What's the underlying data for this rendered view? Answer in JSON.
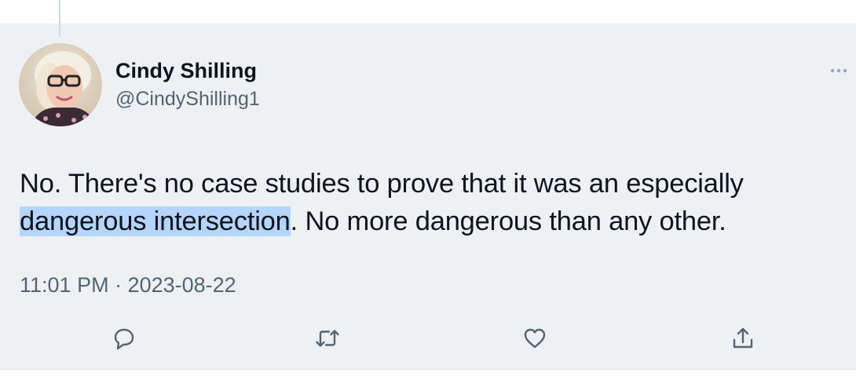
{
  "tweet": {
    "author": {
      "display_name": "Cindy Shilling",
      "handle": "@CindyShilling1"
    },
    "text": {
      "line1": "No. There's no case studies to prove that it was an especially",
      "line2_highlighted": "dangerous intersection",
      "line2_rest": ". No more dangerous than any other."
    },
    "timestamp": "11:01 PM · 2023-08-22",
    "actions": [
      "reply-icon",
      "retweet-icon",
      "like-icon",
      "share-icon"
    ]
  },
  "colors": {
    "card_background": "#eef1f4",
    "text_primary": "#0f1419",
    "text_secondary": "#536471",
    "selection_highlight": "#b4d5fe"
  }
}
